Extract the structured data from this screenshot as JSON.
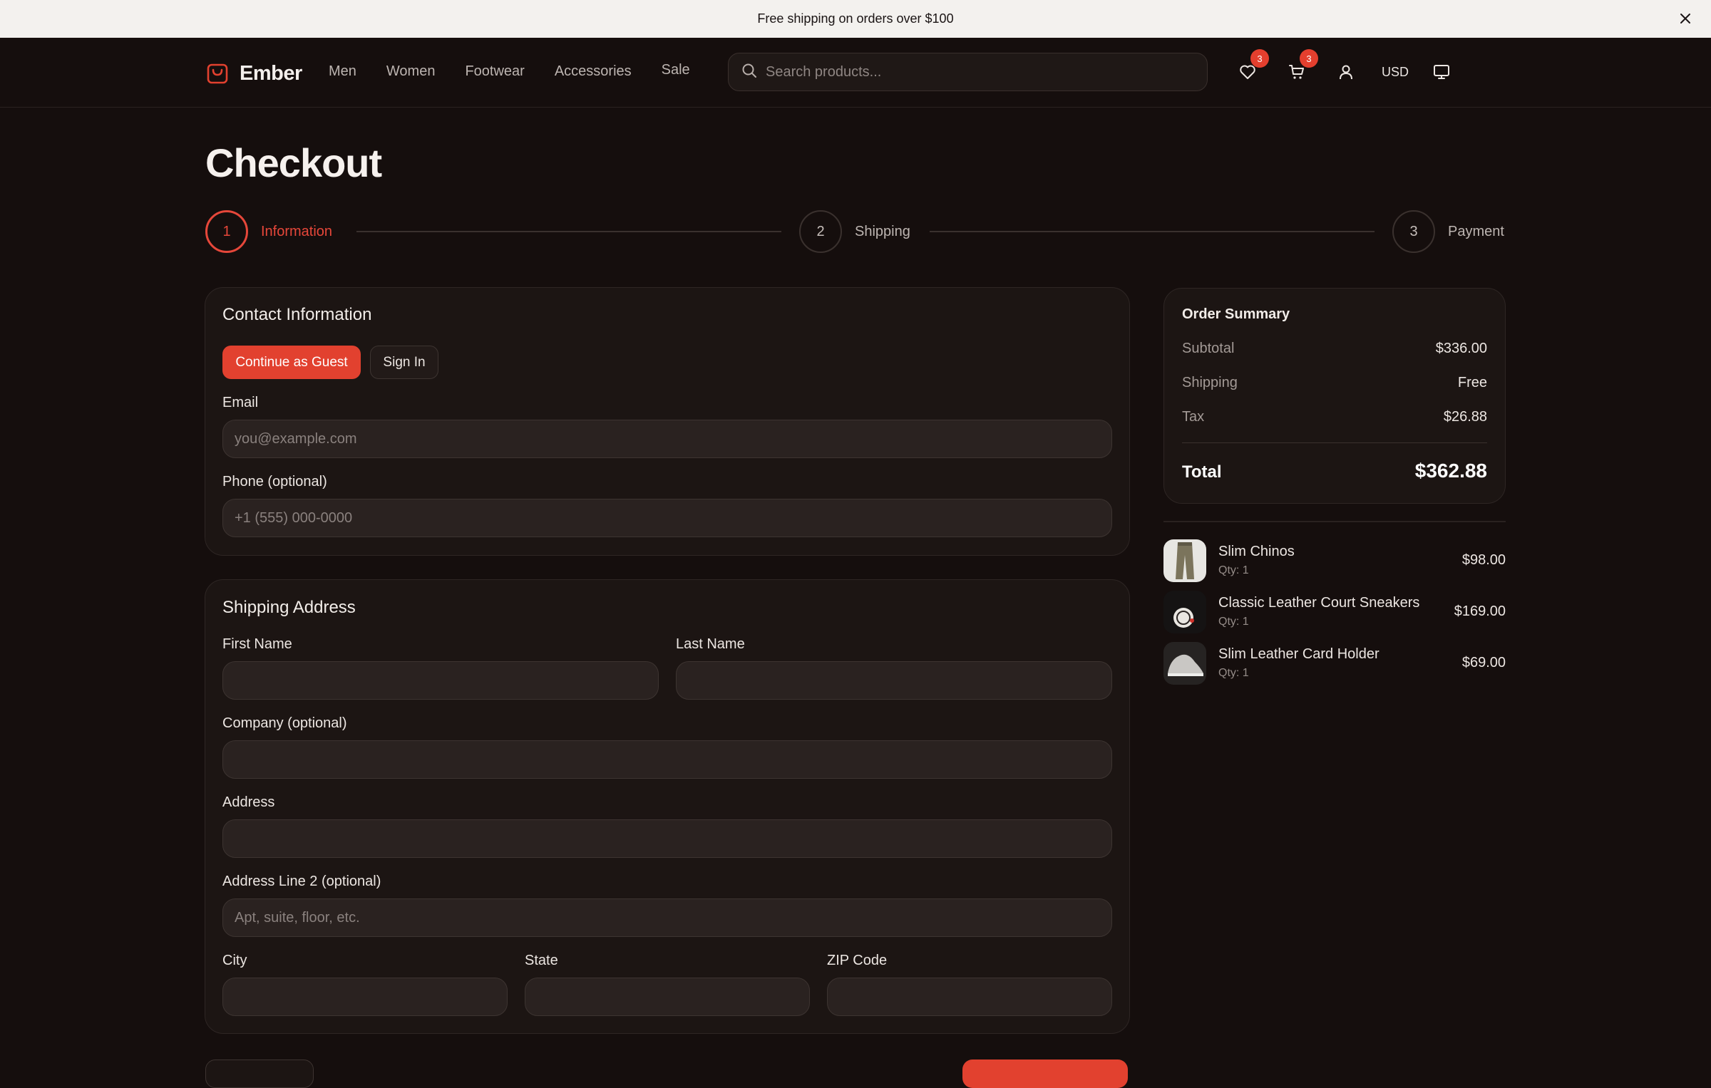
{
  "announcement": {
    "text": "Free shipping on orders over $100"
  },
  "brand": {
    "name": "Ember",
    "accent": "#e2412f"
  },
  "nav": {
    "items": [
      "Men",
      "Women",
      "Footwear",
      "Accessories",
      "Sale"
    ]
  },
  "search": {
    "placeholder": "Search products..."
  },
  "header": {
    "wishlist_count": "3",
    "cart_count": "3",
    "currency": "USD"
  },
  "page": {
    "title": "Checkout"
  },
  "steps": [
    {
      "number": "1",
      "label": "Information",
      "active": true
    },
    {
      "number": "2",
      "label": "Shipping",
      "active": false
    },
    {
      "number": "3",
      "label": "Payment",
      "active": false
    }
  ],
  "contact": {
    "title": "Contact Information",
    "guest_label": "Continue as Guest",
    "signin_label": "Sign In",
    "email_label": "Email",
    "email_placeholder": "you@example.com",
    "email_value": "",
    "phone_label": "Phone (optional)",
    "phone_placeholder": "+1 (555) 000-0000",
    "phone_value": ""
  },
  "shipping": {
    "title": "Shipping Address",
    "first_name_label": "First Name",
    "last_name_label": "Last Name",
    "company_label": "Company (optional)",
    "address_label": "Address",
    "address2_label": "Address Line 2 (optional)",
    "address2_placeholder": "Apt, suite, floor, etc.",
    "city_label": "City",
    "state_label": "State",
    "zip_label": "ZIP Code"
  },
  "summary": {
    "title": "Order Summary",
    "subtotal_label": "Subtotal",
    "subtotal": "$336.00",
    "shipping_label": "Shipping",
    "shipping": "Free",
    "tax_label": "Tax",
    "tax": "$26.88",
    "total_label": "Total",
    "total": "$362.88"
  },
  "items": [
    {
      "name": "Slim Chinos",
      "qty": "Qty: 1",
      "price": "$98.00"
    },
    {
      "name": "Classic Leather Court Sneakers",
      "qty": "Qty: 1",
      "price": "$169.00"
    },
    {
      "name": "Slim Leather Card Holder",
      "qty": "Qty: 1",
      "price": "$69.00"
    }
  ]
}
